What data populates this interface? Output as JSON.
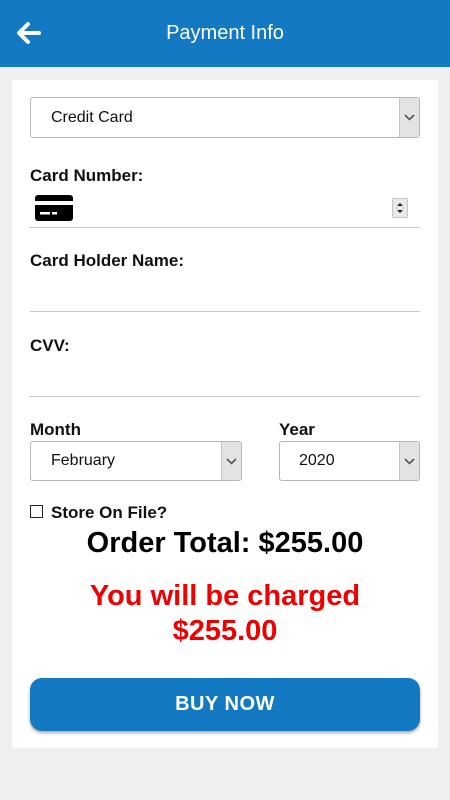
{
  "header": {
    "title": "Payment Info",
    "back_icon": "arrow-left-icon",
    "background": "#1479c3"
  },
  "payment_method": {
    "selected": "Credit Card"
  },
  "card_number": {
    "label": "Card Number:",
    "icon": "credit-card-icon",
    "value": ""
  },
  "card_holder": {
    "label": "Card Holder Name:",
    "value": ""
  },
  "cvv": {
    "label": "CVV:",
    "value": ""
  },
  "month": {
    "label": "Month",
    "selected": "February"
  },
  "year": {
    "label": "Year",
    "selected": "2020"
  },
  "store_on_file": {
    "label": "Store On File?",
    "checked": false
  },
  "order_total": "Order Total: $255.00",
  "charged": {
    "line1": "You will be charged",
    "line2": "$255.00",
    "color": "#ef0000"
  },
  "buy_button": {
    "label": "BUY NOW"
  }
}
